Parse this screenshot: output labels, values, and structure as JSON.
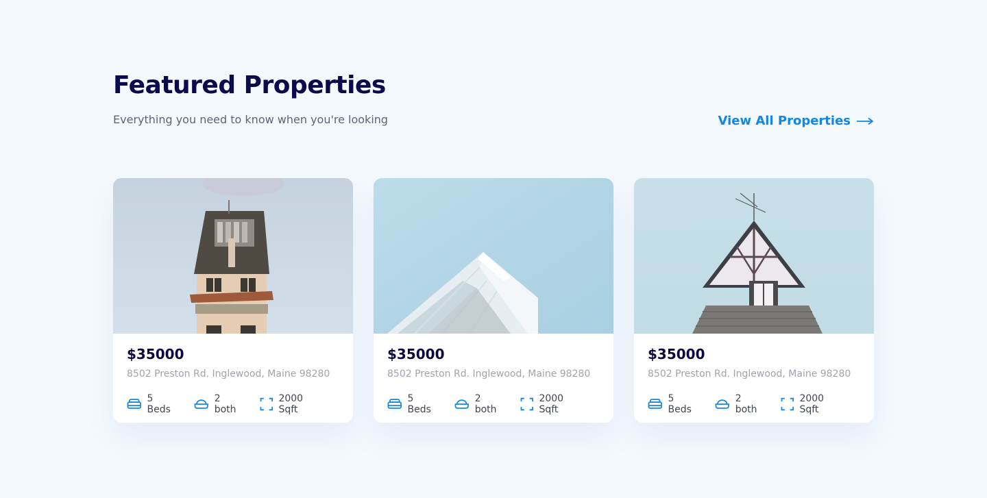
{
  "section": {
    "title": "Featured Properties",
    "subtitle": "Everything you need to know when you're looking",
    "view_all_label": "View All Properties",
    "view_all_icon": "arrow-right-icon"
  },
  "colors": {
    "background": "#f4f9fe",
    "heading": "#0b0a4a",
    "accent": "#1187ea",
    "muted": "#a0a3ab"
  },
  "properties": [
    {
      "image": "tall-old-house-photo",
      "price": "$35000",
      "address": "8502 Preston Rd. Inglewood, Maine 98280",
      "beds": "5 Beds",
      "baths": "2 both",
      "area": "2000 Sqft"
    },
    {
      "image": "modern-glass-building-photo",
      "price": "$35000",
      "address": "8502 Preston Rd. Inglewood, Maine 98280",
      "beds": "5 Beds",
      "baths": "2 both",
      "area": "2000 Sqft"
    },
    {
      "image": "gabled-house-roof-photo",
      "price": "$35000",
      "address": "8502 Preston Rd. Inglewood, Maine 98280",
      "beds": "5 Beds",
      "baths": "2 both",
      "area": "2000 Sqft"
    }
  ],
  "icons": {
    "beds": "bed-icon",
    "baths": "bathtub-icon",
    "area": "area-frame-icon"
  }
}
